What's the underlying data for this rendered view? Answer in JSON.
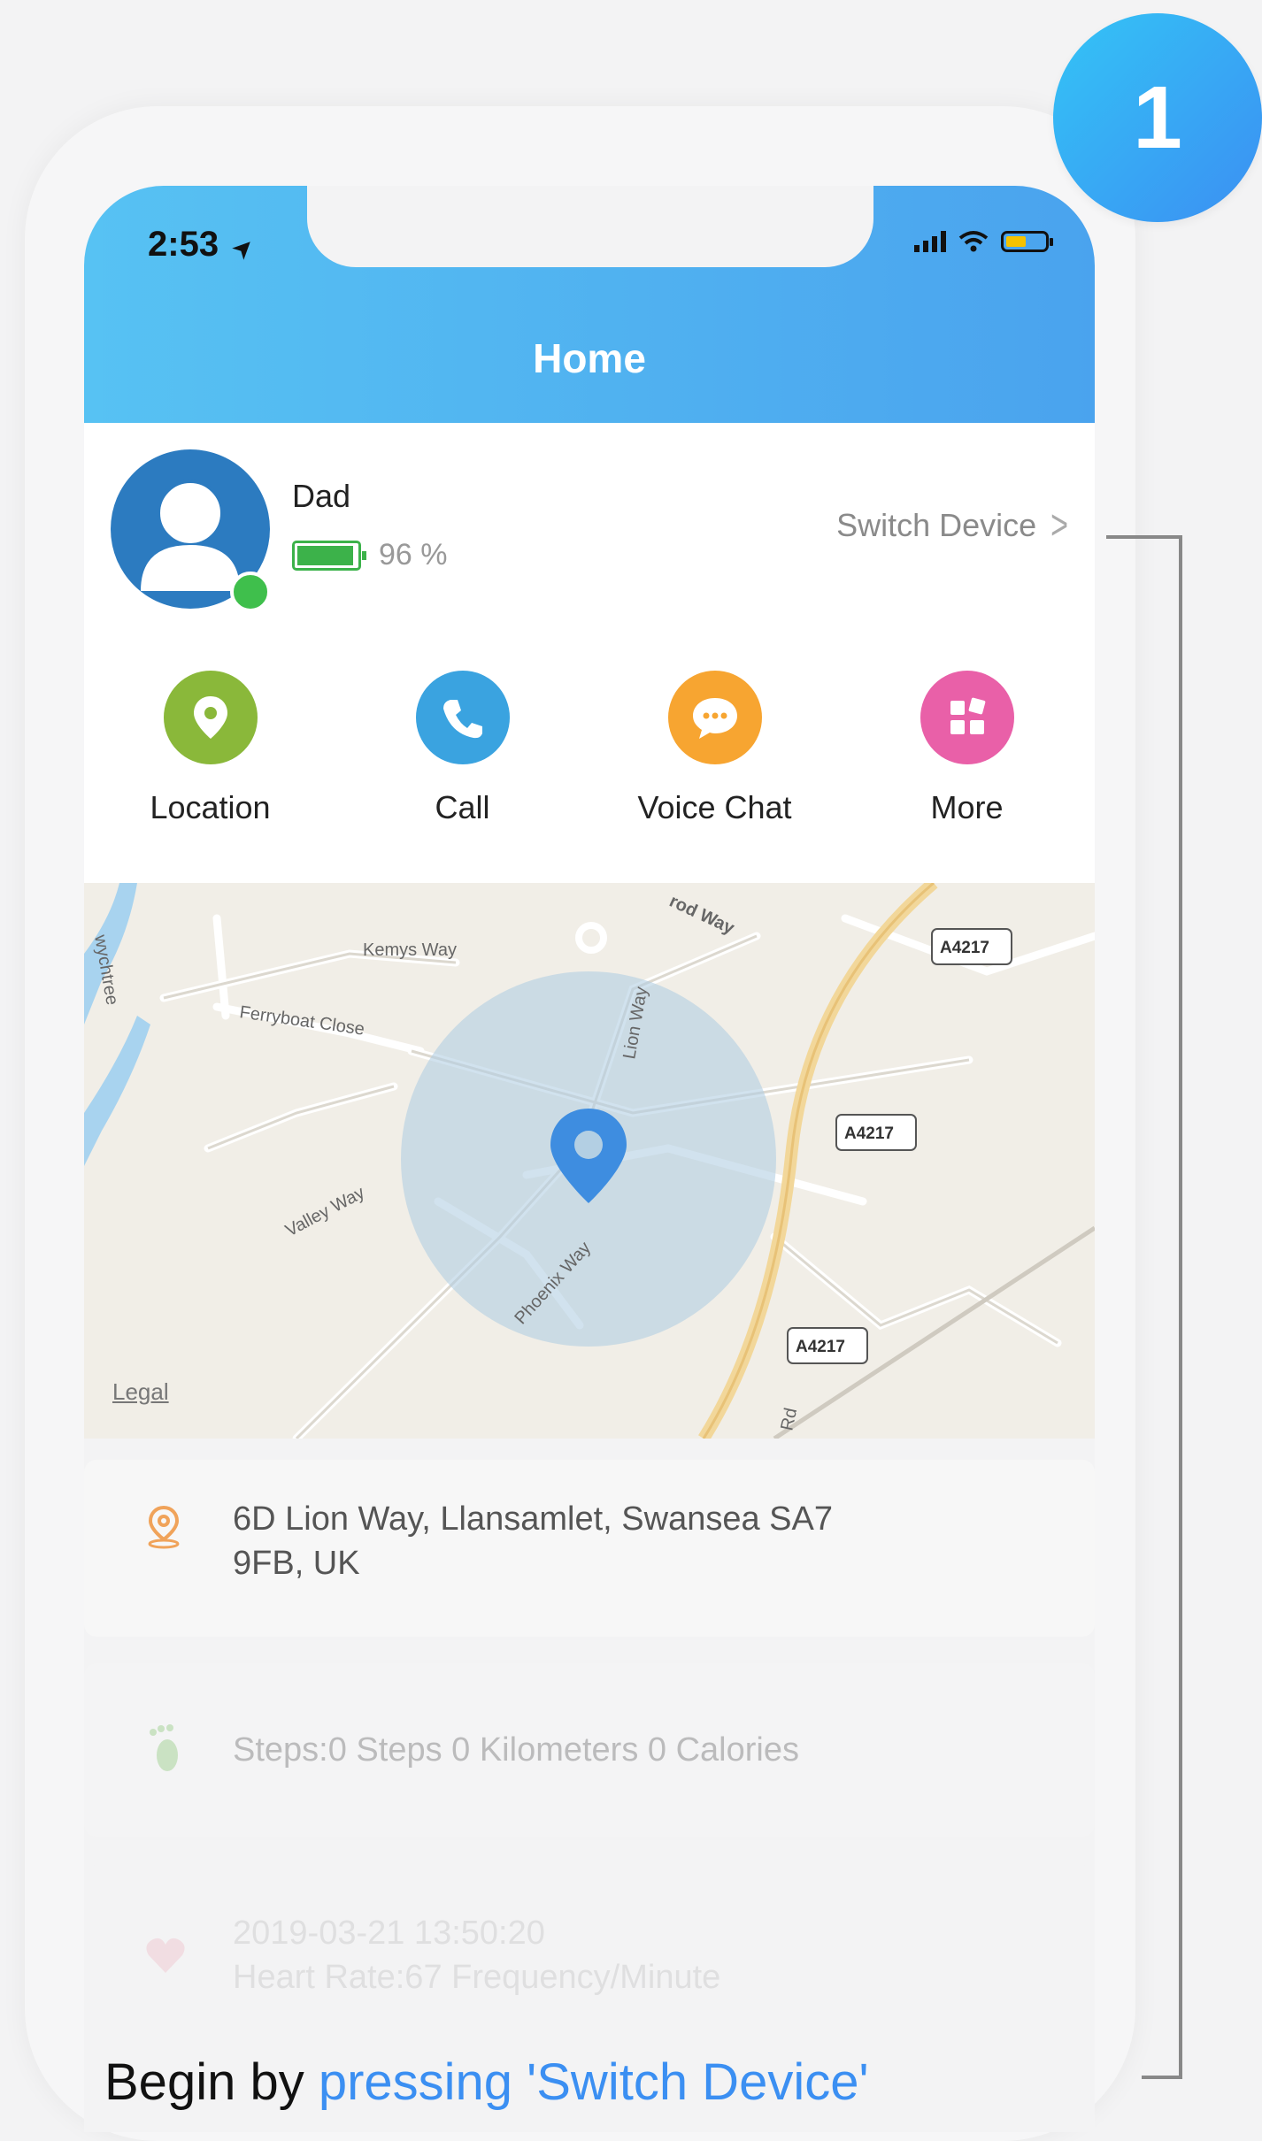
{
  "step": {
    "number": "1"
  },
  "status_bar": {
    "time": "2:53",
    "location_glyph": "➤"
  },
  "header": {
    "title": "Home"
  },
  "device": {
    "name": "Dad",
    "battery_percent": "96 %",
    "battery_level": 0.96,
    "switch_label": "Switch Device",
    "switch_chevron": ">"
  },
  "actions": [
    {
      "label": "Location",
      "icon": "location-pin-icon",
      "color": "#8ab83a"
    },
    {
      "label": "Call",
      "icon": "phone-icon",
      "color": "#3aa3e0"
    },
    {
      "label": "Voice Chat",
      "icon": "chat-bubble-icon",
      "color": "#f7a531"
    },
    {
      "label": "More",
      "icon": "grid-icon",
      "color": "#e960a8"
    }
  ],
  "map": {
    "streets": [
      "Kemys Way",
      "Ferryboat Close",
      "Lion Way",
      "Valley Way",
      "Phoenix Way",
      "Rd",
      "rod Way",
      "wychtree"
    ],
    "road_badges": [
      "A4217",
      "A4217",
      "A4217"
    ],
    "legal": "Legal"
  },
  "address": {
    "text_line1": "6D Lion Way, Llansamlet, Swansea SA7",
    "text_line2": "9FB, UK"
  },
  "steps_card": {
    "text": "Steps:0 Steps 0 Kilometers 0 Calories"
  },
  "heart_card": {
    "time": "2019-03-21 13:50:20",
    "text": "Heart Rate:67  Frequency/Minute"
  },
  "caption": {
    "prefix": "Begin by ",
    "link": "pressing 'Switch Device'"
  },
  "colors": {
    "header_start": "#57c2f3",
    "header_end": "#4aa3ee",
    "badge": "#3b8ff2",
    "online": "#3fbf4c",
    "battery": "#3cb24a"
  }
}
